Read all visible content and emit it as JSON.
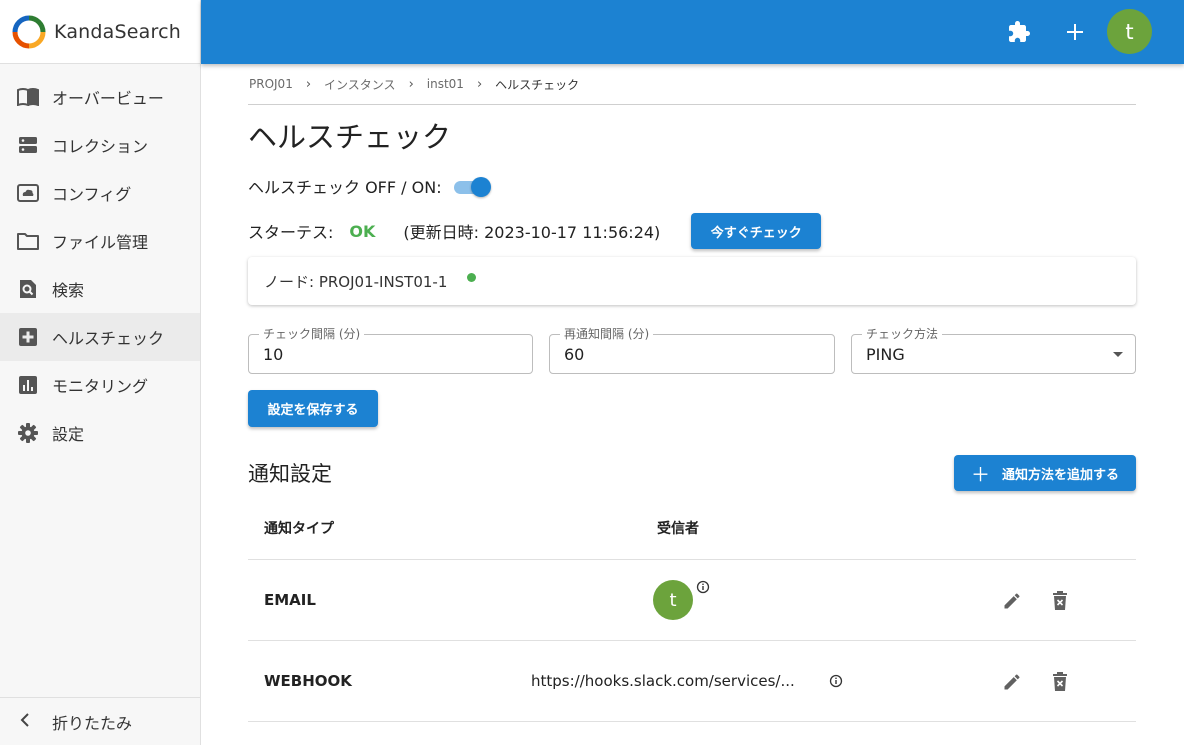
{
  "app": {
    "name": "KandaSearch"
  },
  "sidebar": {
    "items": [
      {
        "label": "オーバービュー",
        "icon": "book-open-icon"
      },
      {
        "label": "コレクション",
        "icon": "storage-icon"
      },
      {
        "label": "コンフィグ",
        "icon": "cloud-settings-icon"
      },
      {
        "label": "ファイル管理",
        "icon": "folder-icon"
      },
      {
        "label": "検索",
        "icon": "search-doc-icon"
      },
      {
        "label": "ヘルスチェック",
        "icon": "medical-plus-icon",
        "active": true
      },
      {
        "label": "モニタリング",
        "icon": "chart-icon"
      },
      {
        "label": "設定",
        "icon": "gear-icon"
      }
    ],
    "collapse_label": "折りたたみ"
  },
  "topbar": {
    "avatar_initial": "t",
    "icons": [
      "extension-icon",
      "plus-icon"
    ],
    "color": "#1c82d2"
  },
  "breadcrumb": [
    "PROJ01",
    "インスタンス",
    "inst01",
    "ヘルスチェック"
  ],
  "page_title": "ヘルスチェック",
  "toggle": {
    "label": "ヘルスチェック OFF / ON:",
    "on": true
  },
  "status": {
    "label": "スターテス:",
    "value": "OK",
    "updated": "(更新日時: 2023-10-17 11:56:24)",
    "check_now_button": "今すぐチェック"
  },
  "node": {
    "label": "ノード: PROJ01-INST01-1",
    "status_color": "#4caf50"
  },
  "settings": {
    "check_interval": {
      "label": "チェック間隔 (分)",
      "value": "10"
    },
    "renotify_interval": {
      "label": "再通知間隔 (分)",
      "value": "60"
    },
    "check_method": {
      "label": "チェック方法",
      "value": "PING"
    },
    "save_button": "設定を保存する"
  },
  "notifications": {
    "title": "通知設定",
    "add_button": "通知方法を追加する",
    "columns": [
      "通知タイプ",
      "受信者"
    ],
    "rows": [
      {
        "type": "EMAIL",
        "recipient_avatar": "t"
      },
      {
        "type": "WEBHOOK",
        "recipient": "https://hooks.slack.com/services/..."
      }
    ]
  }
}
